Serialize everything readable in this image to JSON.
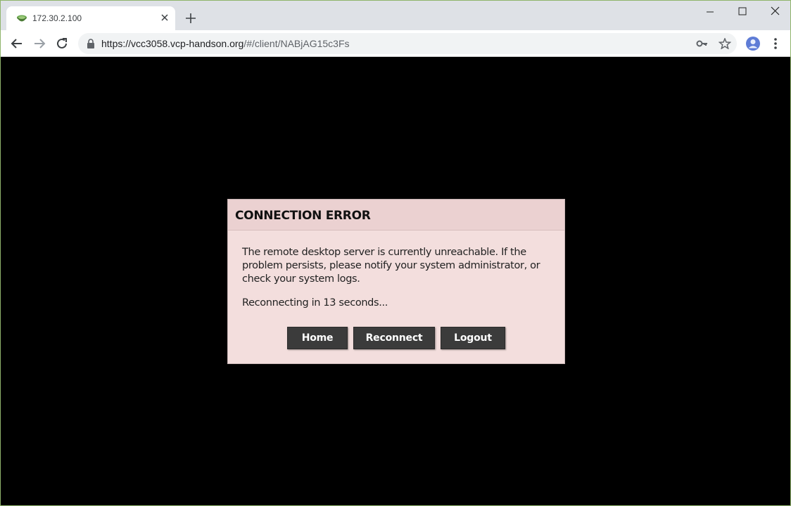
{
  "browser": {
    "tab": {
      "title": "172.30.2.100",
      "favicon": "guacamole-bowl-icon"
    },
    "url": {
      "origin": "https://vcc3058.vcp-handson.org",
      "rest": "/#/client/NABjAG15c3Fs"
    },
    "icons": [
      "back-icon",
      "forward-icon",
      "reload-icon",
      "lock-icon",
      "key-icon",
      "star-icon",
      "avatar-icon",
      "kebab-menu-icon",
      "new-tab-icon",
      "minimize-icon",
      "maximize-icon",
      "close-icon"
    ]
  },
  "dialog": {
    "title": "CONNECTION ERROR",
    "message": "The remote desktop server is currently unreachable. If the problem persists, please notify your system administrator, or check your system logs.",
    "status": "Reconnecting in 13 seconds...",
    "buttons": {
      "home": "Home",
      "reconnect": "Reconnect",
      "logout": "Logout"
    }
  },
  "colors": {
    "dialog_bg": "#f3dedd",
    "header_bg": "#ebd1d1",
    "button_bg": "#3b3b3b",
    "window_border": "#8fb46b"
  }
}
